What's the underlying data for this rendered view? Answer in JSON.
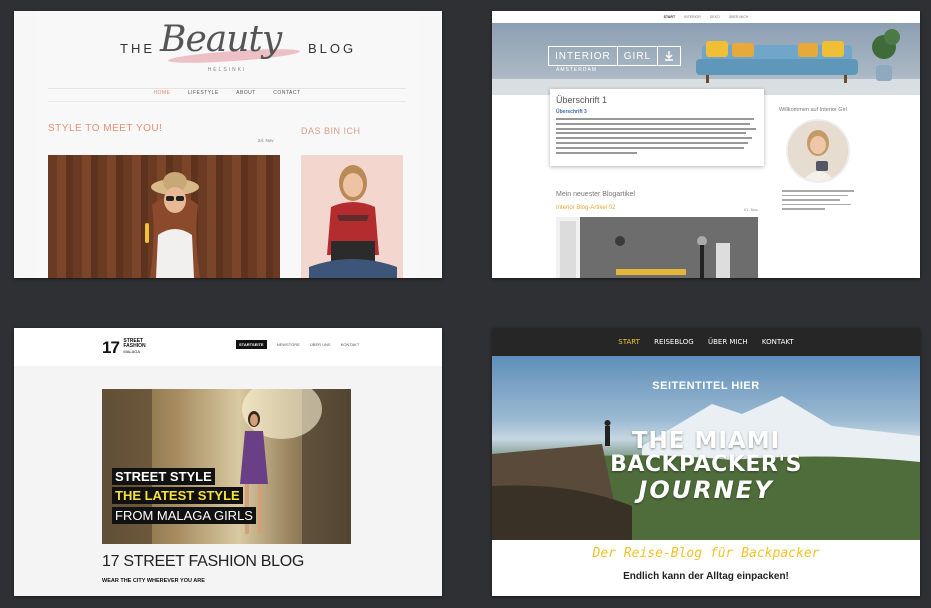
{
  "beauty": {
    "logo_the": "THE",
    "logo_beauty": "Beauty",
    "logo_blog": "BLOG",
    "logo_sub": "HELSINKI",
    "nav": [
      "HOME",
      "LIFESTYLE",
      "ABOUT",
      "CONTACT"
    ],
    "heading": "STYLE TO MEET YOU!",
    "date": "24. Nov",
    "side_heading": "DAS BIN ICH"
  },
  "interior": {
    "topnav": [
      "START",
      "INTERIOR",
      "DEKO",
      "ÜBER MICH"
    ],
    "logo_left": "INTERIOR",
    "logo_right": "GIRL",
    "logo_sub": "AMSTERDAM",
    "box_title": "Überschrift 1",
    "box_sub": "Überschrift 3",
    "sidebar_title": "Willkommen auf Interior Girl",
    "newest": "Mein neuester Blogartikel",
    "article_title": "Interior Blog-Artikel 02",
    "article_date": "01. Nov"
  },
  "fashion": {
    "logo_number": "17",
    "logo_line1": "STREET",
    "logo_line2": "FASHION",
    "logo_line3": "MALAGA",
    "nav": [
      "STARTSEITE",
      "NEWSTORE",
      "ÜBER UNS",
      "KONTAKT"
    ],
    "tag1": "STREET STYLE",
    "tag2": "THE LATEST STYLE",
    "tag3": "FROM MALAGA GIRLS",
    "title": "17 STREET FASHION BLOG",
    "subtitle": "WEAR THE CITY WHEREVER YOU ARE"
  },
  "backpacker": {
    "nav": [
      "START",
      "REISEBLOG",
      "ÜBER MICH",
      "KONTAKT"
    ],
    "page_title": "SEITENTITEL HIER",
    "big1": "THE MIAMI",
    "big2": "BACKPACKER'S",
    "big3": "JOURNEY",
    "tagline": "Der Reise-Blog für Backpacker",
    "subline": "Endlich kann der Alltag einpacken!"
  },
  "colors": {
    "beauty_accent": "#e39073",
    "interior_link": "#3a6ab0",
    "interior_article": "#e0a83a",
    "backpacker_accent": "#f3c33a",
    "fashion_tag_yellow": "#f5e23a"
  }
}
